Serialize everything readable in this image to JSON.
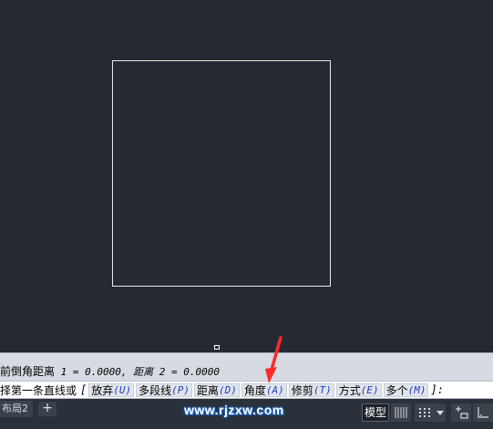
{
  "history": {
    "prefix": "前倒角距离",
    "value_text": " 1 = 0.0000, 距离 2 = 0.0000"
  },
  "command": {
    "prompt": "择第一条直线或",
    "open_bracket": "[",
    "options": [
      {
        "label": "放弃",
        "key": "(U)"
      },
      {
        "label": "多段线",
        "key": "(P)"
      },
      {
        "label": "距离",
        "key": "(D)"
      },
      {
        "label": "角度",
        "key": "(A)"
      },
      {
        "label": "修剪",
        "key": "(T)"
      },
      {
        "label": "方式",
        "key": "(E)"
      },
      {
        "label": "多个",
        "key": "(M)"
      }
    ],
    "close_bracket": "]:"
  },
  "tabs": {
    "layout_tab": "布局2",
    "add_label": "+"
  },
  "status": {
    "model_label": "模型"
  },
  "watermark": "www.rjzxw.com",
  "icons": {
    "grid": "grid-icon",
    "snap": "snap-icon",
    "annotation": "annotation-icon",
    "ortho": "ortho-icon",
    "arrow": "red-arrow-annotation"
  },
  "colors": {
    "canvas": "#252a32",
    "rectangle_stroke": "#e8e8e8",
    "option_key": "#1f3fbf",
    "arrow": "#ff2b2b"
  }
}
